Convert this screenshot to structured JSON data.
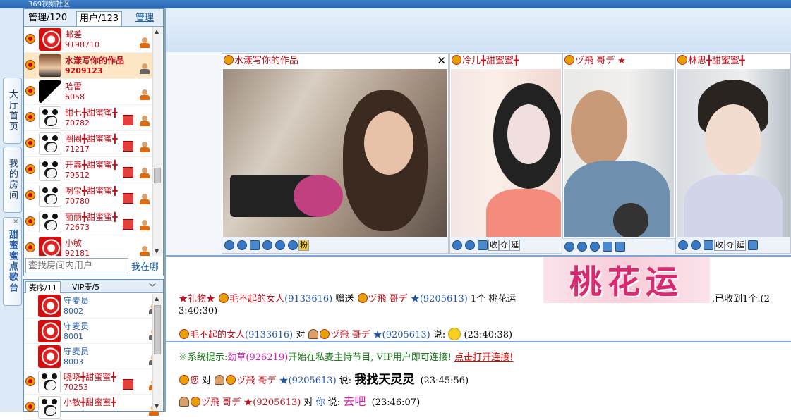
{
  "app": {
    "title": "369视频社区",
    "top_items": [
      "视频社区",
      "…",
      "…",
      "…",
      "…",
      "…"
    ]
  },
  "left_tabs": [
    {
      "label": "大厅首页"
    },
    {
      "label": "我的房间"
    },
    {
      "label": "甜蜜蜜点歌台",
      "close": "✕"
    }
  ],
  "user_panel": {
    "tabs": [
      {
        "label": "管理/120"
      },
      {
        "label": "用户/123"
      },
      {
        "label": "管理"
      }
    ],
    "users": [
      {
        "name": "邮差",
        "id": "9198710",
        "avatar": "logo"
      },
      {
        "name": "水漾写你的作品",
        "id": "9209123",
        "avatar": "photo",
        "highlight": true
      },
      {
        "name": "哈雷",
        "id": "6058",
        "avatar": "black"
      },
      {
        "name": "甜七╋甜蜜蜜╋",
        "id": "70782",
        "avatar": "panda",
        "badge": true
      },
      {
        "name": "圈圈╋甜蜜蜜╋",
        "id": "71217",
        "avatar": "panda",
        "badge": true
      },
      {
        "name": "开鑫╋甜蜜蜜╋",
        "id": "79512",
        "avatar": "panda",
        "badge": true
      },
      {
        "name": "咧宝╋甜蜜蜜╋",
        "id": "70780",
        "avatar": "panda",
        "badge": true
      },
      {
        "name": "丽丽╋甜蜜蜜╋",
        "id": "72673",
        "avatar": "panda",
        "badge": true
      },
      {
        "name": "小敏",
        "id": "92181",
        "avatar": "logo"
      }
    ],
    "search_placeholder": "查找房间内用户",
    "where_label": "我在哪"
  },
  "mic_panel": {
    "tabs": [
      {
        "label": "麦序/11"
      },
      {
        "label": "VIP麦/5"
      }
    ],
    "expand": "︾",
    "rows": [
      {
        "name": "守麦员",
        "id": "8002",
        "avatar": "logo"
      },
      {
        "name": "守麦员",
        "id": "8001",
        "avatar": "logo"
      },
      {
        "name": "守麦员",
        "id": "8003",
        "avatar": "logo"
      },
      {
        "name": "晓晓╋甜蜜蜜╋",
        "id": "70253",
        "avatar": "panda",
        "red": true
      },
      {
        "name": "小敏╋甜蜜蜜╋",
        "id": "",
        "avatar": "panda",
        "red": true
      }
    ]
  },
  "videos": [
    {
      "title": "水漾写你的作品",
      "close": "✕"
    },
    {
      "title": "冷儿╋甜蜜蜜╋"
    },
    {
      "title": "ヅ飛 哥デ ★"
    },
    {
      "title": "林思╋甜蜜蜜╋"
    }
  ],
  "video_tool_labels": {
    "v1": [
      "粉"
    ],
    "v2": [
      "收",
      "夺",
      "延"
    ],
    "v4": [
      "收",
      "夺",
      "延"
    ]
  },
  "chat_top": {
    "line1": {
      "gift_prefix": "★礼物★",
      "sender": "毛不起的女人",
      "sender_id": "(9133616)",
      "verb": "赠送",
      "receiver": "ヅ飛 哥デ",
      "receiver_star": "★",
      "receiver_id": "(9205613)",
      "count": "1个 桃花运",
      "tail": ",已收到1个.(2",
      "tail2": "3:40:30)"
    },
    "gift_image_text": "桃花运",
    "line2": {
      "sender": "毛不起的女人",
      "sender_id": "(9133616)",
      "to": "对",
      "receiver": "ヅ飛 哥デ",
      "receiver_star": "★",
      "receiver_id": "(9205613)",
      "say": "说:",
      "time": "(23:40:38)"
    }
  },
  "chat_bottom": {
    "sys": {
      "prefix": "※系统提示:",
      "name": "劲草",
      "id": "(926219)",
      "text": "开始在私麦主持节目, VIP用户即可连接!",
      "link": "点击打开连接!"
    },
    "msg1": {
      "from": "您",
      "to": "对",
      "receiver": "ヅ飛 哥デ",
      "receiver_star": "★",
      "receiver_id": "(9205613)",
      "say": "说:",
      "text": "我找天灵灵",
      "time": "(23:45:56)"
    },
    "msg2": {
      "from": "ヅ飛 哥デ",
      "star": "★",
      "from_id": "(9205613)",
      "to": "对",
      "you": "你",
      "say": "说:",
      "text": "去吧",
      "time": "(23:46:07)"
    }
  },
  "colors": {
    "accent": "#7aa6da",
    "name_red": "#c0101c",
    "id_blue": "#2255aa",
    "system_green": "#1a7a1a",
    "pink": "#d51fb0"
  }
}
